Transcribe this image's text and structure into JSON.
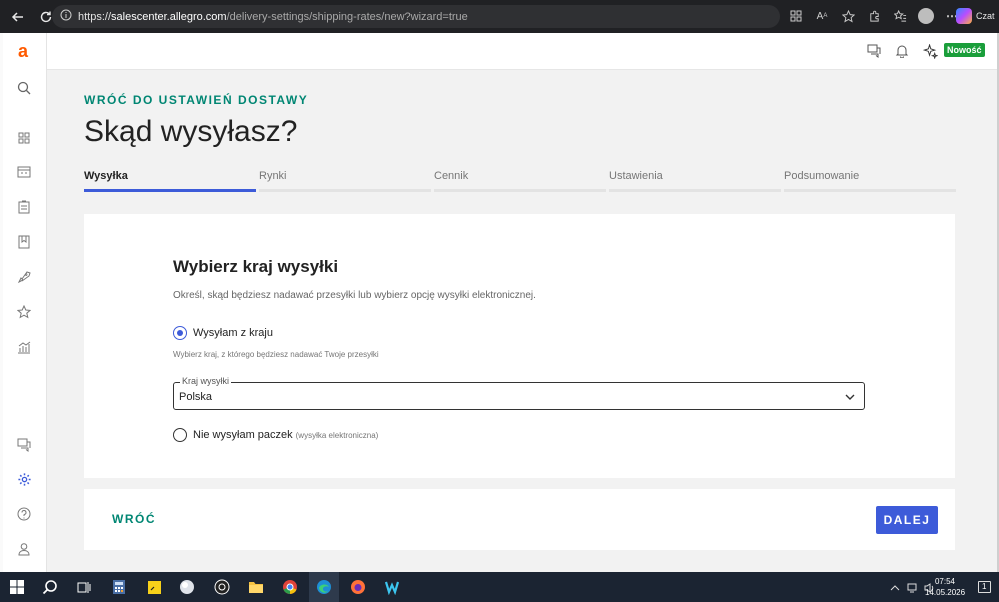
{
  "browser": {
    "url_scheme": "https://",
    "url_host": "salescenter.allegro.com",
    "url_path": "/delivery-settings/shipping-rates/new?wizard=true",
    "copilot_label": "Czat"
  },
  "topbar": {
    "new_badge": "Nowość"
  },
  "sidebar": {
    "logo": "a"
  },
  "page": {
    "back_link": "WRÓĆ DO USTAWIEŃ DOSTAWY",
    "title": "Skąd wysyłasz?"
  },
  "steps": [
    {
      "label": "Wysyłka",
      "active": true
    },
    {
      "label": "Rynki",
      "active": false
    },
    {
      "label": "Cennik",
      "active": false
    },
    {
      "label": "Ustawienia",
      "active": false
    },
    {
      "label": "Podsumowanie",
      "active": false
    }
  ],
  "card": {
    "title": "Wybierz kraj wysyłki",
    "description": "Określ, skąd będziesz nadawać przesyłki lub wybierz opcję wysyłki elektronicznej.",
    "option1_label": "Wysyłam z kraju",
    "option1_hint": "Wybierz kraj, z którego będziesz nadawać Twoje przesyłki",
    "select_legend": "Kraj wysyłki",
    "select_value": "Polska",
    "option2_label": "Nie wysyłam paczek",
    "option2_extra": "(wysyłka elektroniczna)"
  },
  "footer": {
    "back_label": "WRÓĆ",
    "next_label": "DALEJ"
  },
  "taskbar": {
    "time": "07:54",
    "date": "14.05.2026"
  },
  "colors": {
    "accent": "#3d5bd9",
    "teal": "#008673",
    "brand": "#ff5a00",
    "new_badge": "#1a9e3a"
  }
}
